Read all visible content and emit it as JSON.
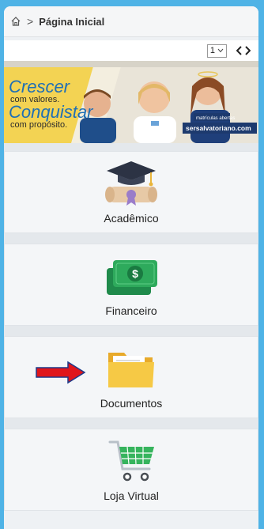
{
  "breadcrumb": {
    "home_icon": "home-icon",
    "separator": ">",
    "current": "Página Inicial"
  },
  "pager": {
    "selected_page": "1",
    "nav_icon": "code-arrows-icon"
  },
  "banner": {
    "line1": "Crescer",
    "line2": "com valores.",
    "line3": "Conquistar",
    "line4": "com propósito.",
    "badge": "matrículas abertas",
    "website": "sersalvatoriano.com"
  },
  "menu": [
    {
      "label": "Acadêmico",
      "icon": "graduation-cap-diploma-icon"
    },
    {
      "label": "Financeiro",
      "icon": "money-bills-icon"
    },
    {
      "label": "Documentos",
      "icon": "folder-icon"
    },
    {
      "label": "Loja Virtual",
      "icon": "shopping-cart-icon"
    }
  ],
  "colors": {
    "background": "#4fb3e6",
    "arrow": "#e0161b",
    "money": "#2eaa5c",
    "folder": "#f6c945",
    "cart": "#36b45d",
    "cap": "#2c3344"
  }
}
